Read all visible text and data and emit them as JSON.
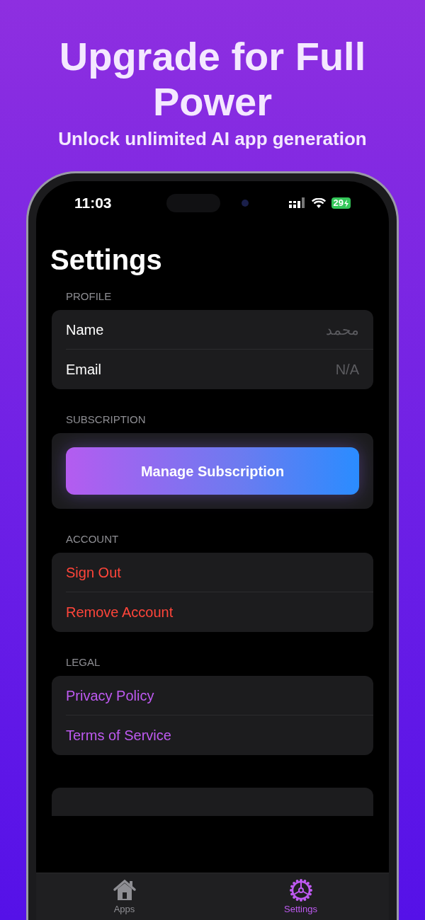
{
  "promo": {
    "title": "Upgrade for Full Power",
    "subtitle": "Unlock unlimited AI app generation"
  },
  "status_bar": {
    "time": "11:03",
    "battery": "29"
  },
  "screen_title": "Settings",
  "sections": [
    {
      "header": "PROFILE",
      "rows": [
        {
          "kind": "info",
          "label": "Name",
          "value": "محمد"
        },
        {
          "kind": "info",
          "label": "Email",
          "value": "N/A"
        }
      ]
    },
    {
      "header": "SUBSCRIPTION",
      "rows": [
        {
          "kind": "gradient_button",
          "label": "Manage Subscription"
        }
      ]
    },
    {
      "header": "ACCOUNT",
      "rows": [
        {
          "kind": "destructive",
          "label": "Sign Out"
        },
        {
          "kind": "destructive",
          "label": "Remove Account"
        }
      ]
    },
    {
      "header": "LEGAL",
      "rows": [
        {
          "kind": "link",
          "label": "Privacy Policy"
        },
        {
          "kind": "link",
          "label": "Terms of Service"
        }
      ]
    }
  ],
  "tab_bar": [
    {
      "kind": "home",
      "label": "Apps",
      "selected": false
    },
    {
      "kind": "settings",
      "label": "Settings",
      "selected": true
    }
  ]
}
